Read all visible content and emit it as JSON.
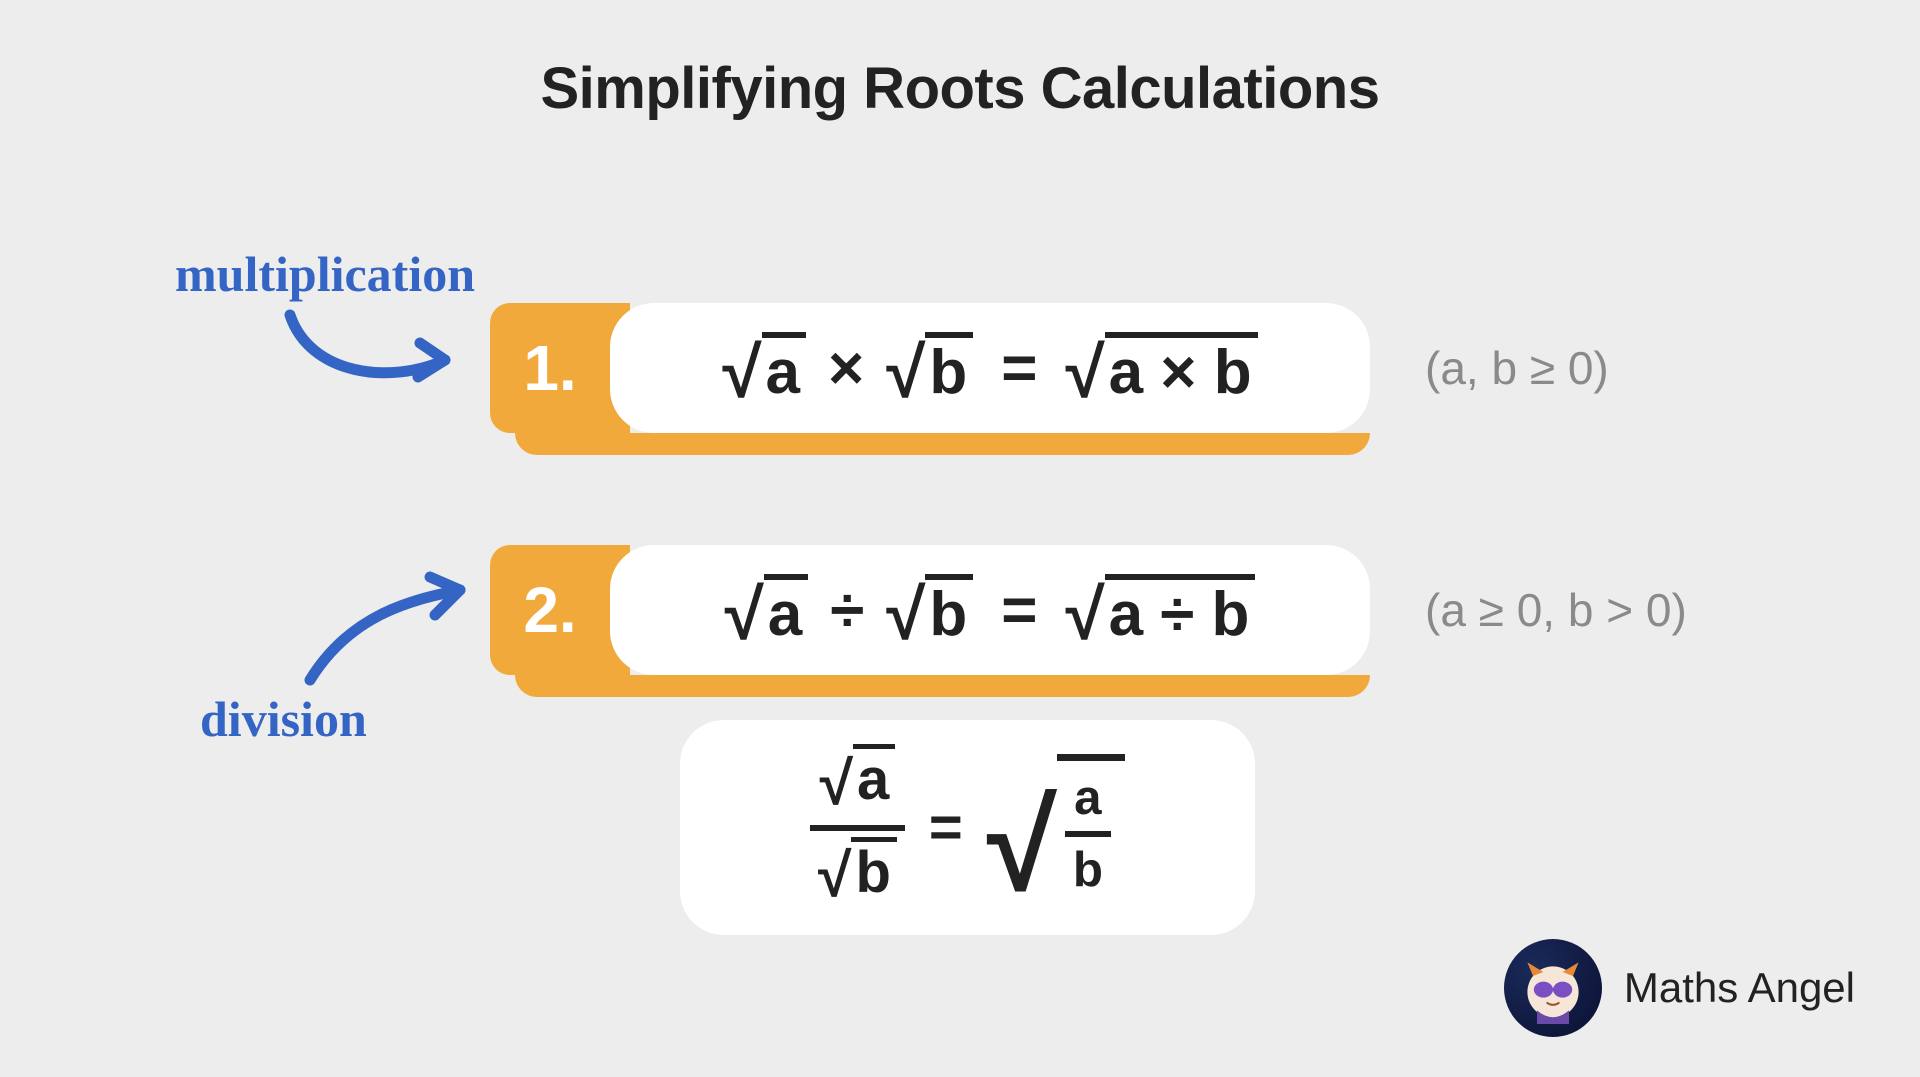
{
  "title": "Simplifying Roots Calculations",
  "annotations": {
    "multiplication": "multiplication",
    "division": "division"
  },
  "rules": [
    {
      "number": "1.",
      "lhs_a": "a",
      "lhs_b": "b",
      "operator": "×",
      "rhs_inner": "a × b",
      "condition": "(a, b ≥ 0)"
    },
    {
      "number": "2.",
      "lhs_a": "a",
      "lhs_b": "b",
      "operator": "÷",
      "rhs_inner": "a ÷ b",
      "condition": "(a ≥ 0, b > 0)"
    }
  ],
  "fraction_form": {
    "num": "a",
    "den": "b",
    "equals": "="
  },
  "brand": "Maths Angel"
}
